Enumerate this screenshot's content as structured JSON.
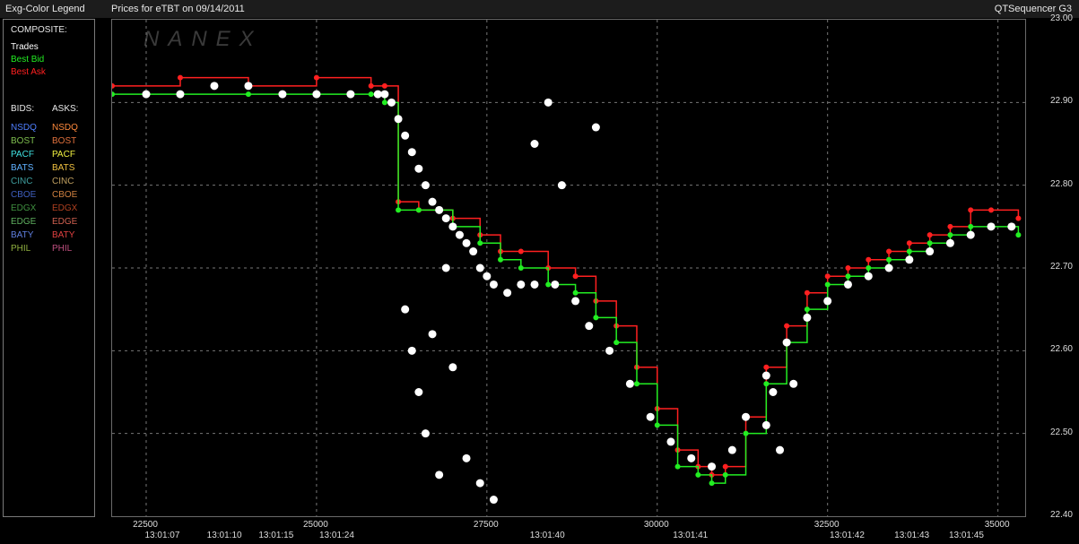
{
  "window": {
    "legend_title": "Exg-Color Legend",
    "chart_title": "Prices for  eTBT  on  09/14/2011",
    "app_name": "QTSequencer G3"
  },
  "legend": {
    "composite_label": "COMPOSITE:",
    "composite": [
      {
        "label": "Trades",
        "color": "#ffffff"
      },
      {
        "label": "Best Bid",
        "color": "#22ee22"
      },
      {
        "label": "Best Ask",
        "color": "#ff2020"
      }
    ],
    "bids_label": "BIDS:",
    "asks_label": "ASKS:",
    "exchanges": [
      {
        "bid": "NSDQ",
        "bid_color": "#4f7fff",
        "ask": "NSDQ",
        "ask_color": "#ff8a3c"
      },
      {
        "bid": "BOST",
        "bid_color": "#7fbf4f",
        "ask": "BOST",
        "ask_color": "#e0703c"
      },
      {
        "bid": "PACF",
        "bid_color": "#3fe0e0",
        "ask": "PACF",
        "ask_color": "#f0f040"
      },
      {
        "bid": "BATS",
        "bid_color": "#5fb0ff",
        "ask": "BATS",
        "ask_color": "#f0c040"
      },
      {
        "bid": "CINC",
        "bid_color": "#3f9f9f",
        "ask": "CINC",
        "ask_color": "#c0a060"
      },
      {
        "bid": "CBOE",
        "bid_color": "#3f5fbf",
        "ask": "CBOE",
        "ask_color": "#d08040"
      },
      {
        "bid": "EDGX",
        "bid_color": "#3f8f3f",
        "ask": "EDGX",
        "ask_color": "#b04020"
      },
      {
        "bid": "EDGE",
        "bid_color": "#5faf5f",
        "ask": "EDGE",
        "ask_color": "#d06050"
      },
      {
        "bid": "BATY",
        "bid_color": "#5f7fdf",
        "ask": "BATY",
        "ask_color": "#e04040"
      },
      {
        "bid": "PHIL",
        "bid_color": "#8faf3f",
        "ask": "PHIL",
        "ask_color": "#c05080"
      }
    ]
  },
  "chart_data": {
    "type": "scatter",
    "watermark": "NANEX",
    "xlim": [
      22000,
      35400
    ],
    "ylim": [
      22.4,
      23.0
    ],
    "grid": true,
    "y_ticks": [
      22.4,
      22.5,
      22.6,
      22.7,
      22.8,
      22.9,
      23.0
    ],
    "y_tick_labels": [
      "22.40",
      "22.50",
      "22.60",
      "22.70",
      "22.80",
      "22.90",
      "23.00"
    ],
    "x_ticks": [
      22500,
      25000,
      27500,
      30000,
      32500,
      35000
    ],
    "x_tick_labels": [
      "22500",
      "25000",
      "27500",
      "30000",
      "32500",
      "35000"
    ],
    "time_labels": [
      {
        "x": 22750,
        "label": "13:01:07"
      },
      {
        "x": 23660,
        "label": "13:01:10"
      },
      {
        "x": 24420,
        "label": "13:01:15"
      },
      {
        "x": 25310,
        "label": "13:01:24"
      },
      {
        "x": 28400,
        "label": "13:01:40"
      },
      {
        "x": 30500,
        "label": "13:01:41"
      },
      {
        "x": 32800,
        "label": "13:01:42"
      },
      {
        "x": 33750,
        "label": "13:01:43"
      },
      {
        "x": 34550,
        "label": "13:01:45"
      }
    ],
    "series": [
      {
        "name": "Best Ask",
        "color": "#ff2020",
        "x": [
          22000,
          23000,
          24000,
          25000,
          25800,
          26000,
          26200,
          26500,
          26800,
          27000,
          27400,
          27700,
          28000,
          28400,
          28800,
          29100,
          29400,
          29700,
          30000,
          30300,
          30600,
          30800,
          31000,
          31300,
          31600,
          31900,
          32200,
          32500,
          32800,
          33100,
          33400,
          33700,
          34000,
          34300,
          34600,
          34900,
          35300
        ],
        "y": [
          22.92,
          22.93,
          22.92,
          22.93,
          22.92,
          22.92,
          22.78,
          22.77,
          22.77,
          22.76,
          22.74,
          22.72,
          22.72,
          22.7,
          22.69,
          22.66,
          22.63,
          22.58,
          22.53,
          22.48,
          22.46,
          22.45,
          22.46,
          22.52,
          22.58,
          22.63,
          22.67,
          22.69,
          22.7,
          22.71,
          22.72,
          22.73,
          22.74,
          22.75,
          22.77,
          22.77,
          22.76
        ]
      },
      {
        "name": "Best Bid",
        "color": "#22ee22",
        "x": [
          22000,
          23000,
          24000,
          25000,
          25800,
          26000,
          26200,
          26500,
          26800,
          27000,
          27400,
          27700,
          28000,
          28400,
          28800,
          29100,
          29400,
          29700,
          30000,
          30300,
          30600,
          30800,
          31000,
          31300,
          31600,
          31900,
          32200,
          32500,
          32800,
          33100,
          33400,
          33700,
          34000,
          34300,
          34600,
          34900,
          35300
        ],
        "y": [
          22.91,
          22.91,
          22.91,
          22.91,
          22.91,
          22.9,
          22.77,
          22.77,
          22.77,
          22.75,
          22.73,
          22.71,
          22.7,
          22.68,
          22.67,
          22.64,
          22.61,
          22.56,
          22.51,
          22.46,
          22.45,
          22.44,
          22.45,
          22.5,
          22.56,
          22.61,
          22.65,
          22.68,
          22.69,
          22.7,
          22.71,
          22.72,
          22.73,
          22.74,
          22.75,
          22.75,
          22.74
        ]
      },
      {
        "name": "Trades",
        "color": "#ffffff",
        "x": [
          22500,
          23000,
          23500,
          24000,
          24500,
          25000,
          25500,
          25900,
          26000,
          26100,
          26200,
          26300,
          26400,
          26500,
          26600,
          26700,
          26800,
          26900,
          27000,
          27100,
          27200,
          27300,
          27400,
          27500,
          27600,
          27800,
          28000,
          28200,
          28500,
          28800,
          29000,
          29300,
          29600,
          29900,
          30200,
          30500,
          30800,
          31100,
          31300,
          31600,
          31900,
          32200,
          32500,
          32800,
          33100,
          33400,
          33700,
          34000,
          34300,
          34600,
          34900,
          35200,
          26300,
          26400,
          26500,
          26600,
          26700,
          26800,
          26900,
          27000,
          27200,
          27400,
          27600,
          28200,
          28400,
          28600,
          29100,
          31700,
          31600,
          31800,
          32000
        ],
        "y": [
          22.91,
          22.91,
          22.92,
          22.92,
          22.91,
          22.91,
          22.91,
          22.91,
          22.91,
          22.9,
          22.88,
          22.86,
          22.84,
          22.82,
          22.8,
          22.78,
          22.77,
          22.76,
          22.75,
          22.74,
          22.73,
          22.72,
          22.7,
          22.69,
          22.68,
          22.67,
          22.68,
          22.68,
          22.68,
          22.66,
          22.63,
          22.6,
          22.56,
          22.52,
          22.49,
          22.47,
          22.46,
          22.48,
          22.52,
          22.57,
          22.61,
          22.64,
          22.66,
          22.68,
          22.69,
          22.7,
          22.71,
          22.72,
          22.73,
          22.74,
          22.75,
          22.75,
          22.65,
          22.6,
          22.55,
          22.5,
          22.62,
          22.45,
          22.7,
          22.58,
          22.47,
          22.44,
          22.42,
          22.85,
          22.9,
          22.8,
          22.87,
          22.55,
          22.51,
          22.48,
          22.56
        ]
      }
    ]
  }
}
